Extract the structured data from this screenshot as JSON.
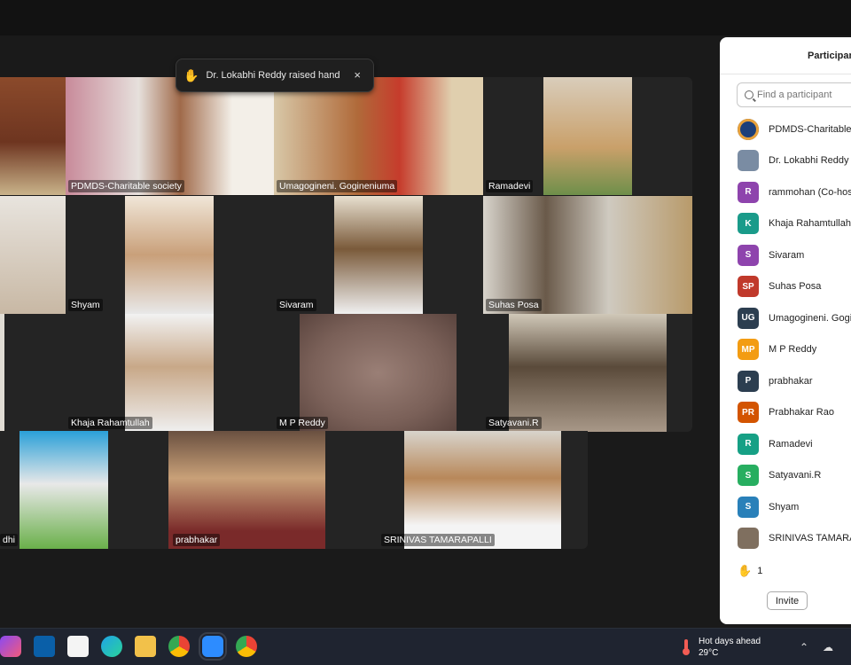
{
  "notification": {
    "text": "Dr. Lokabhi Reddy raised hand",
    "close": "×"
  },
  "tiles": {
    "row1": [
      "",
      "PDMDS-Charitable society",
      "Umagogineni. Gogineniuma",
      "Ramadevi"
    ],
    "row2": [
      "",
      "Shyam",
      "Sivaram",
      "Suhas Posa"
    ],
    "row3": [
      "",
      "Khaja Rahamtullah",
      "M P Reddy",
      "Satyavani.R"
    ],
    "row4": [
      "dhi",
      "prabhakar",
      "SRINIVAS TAMARAPALLI"
    ]
  },
  "panel": {
    "title": "Participan",
    "search_placeholder": "Find a participant",
    "participants": [
      {
        "initials": "",
        "name": "PDMDS-Charitable",
        "color": "#1c3f7a"
      },
      {
        "initials": "",
        "name": "Dr. Lokabhi Reddy",
        "color": "#7a8ca3"
      },
      {
        "initials": "R",
        "name": "rammohan (Co-hos",
        "color": "#8e44ad"
      },
      {
        "initials": "K",
        "name": "Khaja Rahamtullah",
        "color": "#1a9b8a"
      },
      {
        "initials": "S",
        "name": "Sivaram",
        "color": "#8e44ad"
      },
      {
        "initials": "SP",
        "name": "Suhas Posa",
        "color": "#c0392b"
      },
      {
        "initials": "UG",
        "name": "Umagogineni. Gogi",
        "color": "#2c3e50"
      },
      {
        "initials": "MP",
        "name": "M P Reddy",
        "color": "#f39c12"
      },
      {
        "initials": "P",
        "name": "prabhakar",
        "color": "#2c3e50"
      },
      {
        "initials": "PR",
        "name": "Prabhakar Rao",
        "color": "#d35400"
      },
      {
        "initials": "R",
        "name": "Ramadevi",
        "color": "#16a085"
      },
      {
        "initials": "S",
        "name": "Satyavani.R",
        "color": "#27ae60"
      },
      {
        "initials": "S",
        "name": "Shyam",
        "color": "#2980b9"
      },
      {
        "initials": "",
        "name": "SRINIVAS TAMARA",
        "color": "#7f6f5f"
      }
    ],
    "raised_hands": "1",
    "invite_label": "Invite"
  },
  "taskbar": {
    "weather_title": "Hot days ahead",
    "weather_temp": "29°C"
  }
}
